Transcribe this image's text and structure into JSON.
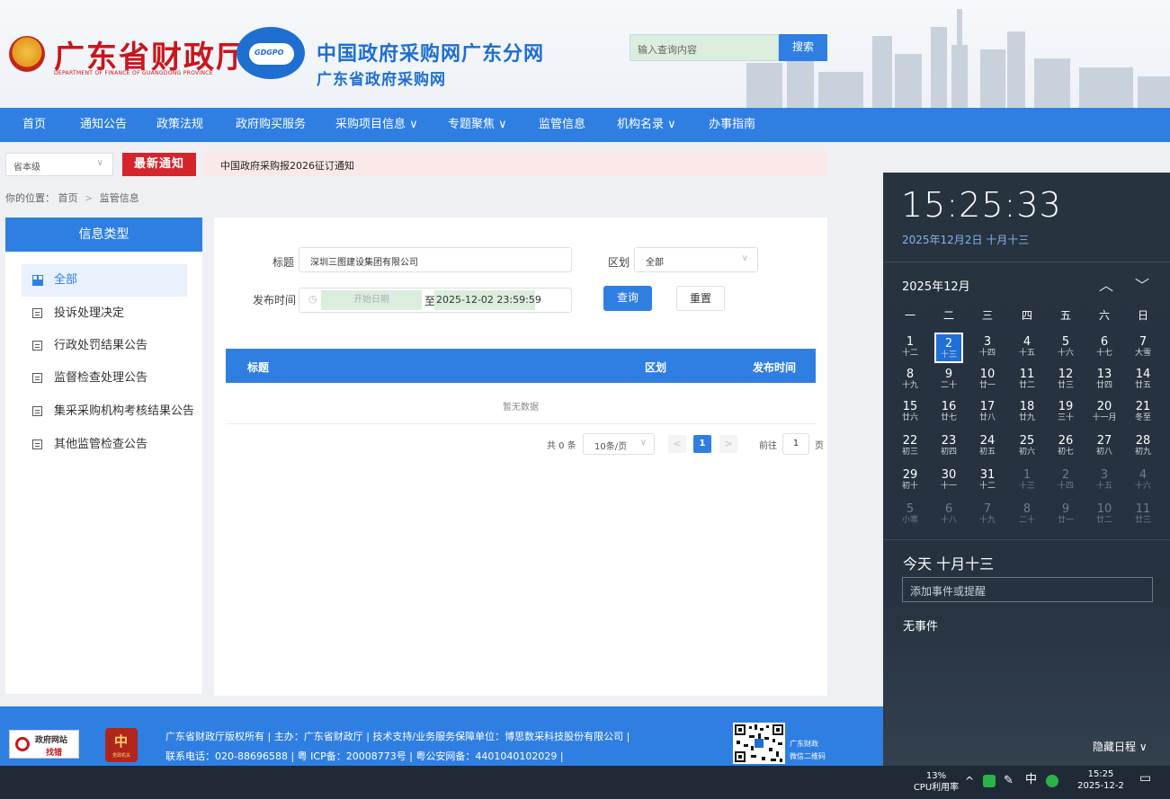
{
  "header": {
    "dept_title": "广东省财政厅",
    "dept_subtitle": "DEPARTMENT OF FINANCE OF GUANGDONG PROVINCE",
    "gdgpo_logo_text": "GDGPO",
    "site_title": "中国政府采购网广东分网",
    "site_subtitle": "广东省政府采购网",
    "search_placeholder": "输入查询内容",
    "search_button": "搜索"
  },
  "nav": [
    {
      "label": "首页"
    },
    {
      "label": "通知公告"
    },
    {
      "label": "政策法规"
    },
    {
      "label": "政府购买服务"
    },
    {
      "label": "采购项目信息 ∨"
    },
    {
      "label": "专题聚焦 ∨"
    },
    {
      "label": "监管信息"
    },
    {
      "label": "机构名录 ∨"
    },
    {
      "label": "办事指南"
    }
  ],
  "notice": {
    "region": "省本级",
    "badge": "最新通知",
    "text": "中国政府采购报2026征订通知"
  },
  "breadcrumb": {
    "prefix": "你的位置：",
    "home": "首页",
    "sep": ">",
    "current": "监管信息"
  },
  "sidebar": {
    "title": "信息类型",
    "items": [
      {
        "label": "全部"
      },
      {
        "label": "投诉处理决定"
      },
      {
        "label": "行政处罚结果公告"
      },
      {
        "label": "监督检查处理公告"
      },
      {
        "label": "集采采购机构考核结果公告"
      },
      {
        "label": "其他监管检查公告"
      }
    ]
  },
  "filters": {
    "title_label": "标题",
    "title_value": "深圳三图建设集团有限公司",
    "region_label": "区划",
    "region_value": "全部",
    "time_label": "发布时间",
    "start_placeholder": "开始日期",
    "to_label": "至",
    "end_value": "2025-12-02 23:59:59",
    "query_button": "查询",
    "reset_button": "重置"
  },
  "table": {
    "headers": [
      "标题",
      "区划",
      "发布时间"
    ],
    "empty_text": "暂无数据"
  },
  "pagination": {
    "total": "共 0 条",
    "page_size": "10条/页",
    "prev": "<",
    "current": "1",
    "next": ">",
    "goto_label": "前往",
    "goto_value": "1",
    "page_suffix": "页"
  },
  "footer": {
    "logo1_line1": "政府网站",
    "logo1_line2": "找错",
    "logo2_text": "党政机关",
    "line1": "广东省财政厅版权所有 | 主办：广东省财政厅 | 技术支持/业务服务保障单位：博思数采科技股份有限公司 |",
    "line2": "联系电话：020-88696588 | 粤 ICP备：20008773号 | 粤公安网备：4401040102029 |",
    "qr_label1": "广东财政",
    "qr_label2": "微信二维码"
  },
  "calendar": {
    "clock": "15:25:33",
    "date_full": "2025年12月2日 十月十三",
    "month": "2025年12月",
    "weekdays": [
      "一",
      "二",
      "三",
      "四",
      "五",
      "六",
      "日"
    ],
    "weeks": [
      [
        {
          "n": "1",
          "l": "十二"
        },
        {
          "n": "2",
          "l": "十三",
          "today": true
        },
        {
          "n": "3",
          "l": "十四"
        },
        {
          "n": "4",
          "l": "十五"
        },
        {
          "n": "5",
          "l": "十六"
        },
        {
          "n": "6",
          "l": "十七"
        },
        {
          "n": "7",
          "l": "大雪"
        }
      ],
      [
        {
          "n": "8",
          "l": "十九"
        },
        {
          "n": "9",
          "l": "二十"
        },
        {
          "n": "10",
          "l": "廿一"
        },
        {
          "n": "11",
          "l": "廿二"
        },
        {
          "n": "12",
          "l": "廿三"
        },
        {
          "n": "13",
          "l": "廿四"
        },
        {
          "n": "14",
          "l": "廿五"
        }
      ],
      [
        {
          "n": "15",
          "l": "廿六"
        },
        {
          "n": "16",
          "l": "廿七"
        },
        {
          "n": "17",
          "l": "廿八"
        },
        {
          "n": "18",
          "l": "廿九"
        },
        {
          "n": "19",
          "l": "三十"
        },
        {
          "n": "20",
          "l": "十一月"
        },
        {
          "n": "21",
          "l": "冬至"
        }
      ],
      [
        {
          "n": "22",
          "l": "初三"
        },
        {
          "n": "23",
          "l": "初四"
        },
        {
          "n": "24",
          "l": "初五"
        },
        {
          "n": "25",
          "l": "初六"
        },
        {
          "n": "26",
          "l": "初七"
        },
        {
          "n": "27",
          "l": "初八"
        },
        {
          "n": "28",
          "l": "初九"
        }
      ],
      [
        {
          "n": "29",
          "l": "初十"
        },
        {
          "n": "30",
          "l": "十一"
        },
        {
          "n": "31",
          "l": "十二"
        },
        {
          "n": "1",
          "l": "十三",
          "other": true
        },
        {
          "n": "2",
          "l": "十四",
          "other": true
        },
        {
          "n": "3",
          "l": "十五",
          "other": true
        },
        {
          "n": "4",
          "l": "十六",
          "other": true
        }
      ],
      [
        {
          "n": "5",
          "l": "小寒",
          "other": true
        },
        {
          "n": "6",
          "l": "十八",
          "other": true
        },
        {
          "n": "7",
          "l": "十九",
          "other": true
        },
        {
          "n": "8",
          "l": "二十",
          "other": true
        },
        {
          "n": "9",
          "l": "廿一",
          "other": true
        },
        {
          "n": "10",
          "l": "廿二",
          "other": true
        },
        {
          "n": "11",
          "l": "廿三",
          "other": true
        }
      ]
    ],
    "today_label": "今天 十月十三",
    "event_placeholder": "添加事件或提醒",
    "no_event": "无事件",
    "hide_schedule": "隐藏日程 ∨"
  },
  "taskbar": {
    "cpu_percent": "13%",
    "cpu_label": "CPU利用率",
    "ime": "中",
    "time": "15:25",
    "date": "2025-12-2"
  },
  "colors": {
    "primary_blue": "#2f7fe3",
    "dept_red": "#c8161d",
    "notice_red": "#d3252b",
    "flyout_bg": "#283340",
    "today_blue": "#1f6fd6"
  }
}
